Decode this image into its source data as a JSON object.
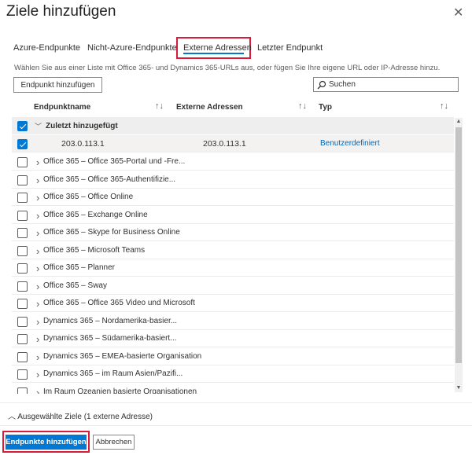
{
  "header": {
    "title": "Ziele hinzufügen",
    "close_glyph": "✕"
  },
  "tabs": [
    {
      "label": "Azure-Endpunkte"
    },
    {
      "label": "Nicht-Azure-Endpunkte"
    },
    {
      "label": "Externe Adressen",
      "active": true
    },
    {
      "label": "Letzter Endpunkt"
    }
  ],
  "description": "Wählen Sie aus einer Liste mit Office 365- und Dynamics 365-URLs aus, oder fügen Sie Ihre eigene URL oder IP-Adresse hinzu.",
  "toolbar": {
    "add_endpoint_label": "Endpunkt hinzufügen"
  },
  "search": {
    "placeholder": "Suchen",
    "icon": "search-icon"
  },
  "table": {
    "columns": [
      {
        "label": "Endpunktname"
      },
      {
        "label": "Externe Adressen"
      },
      {
        "label": "Typ"
      }
    ],
    "sort_glyph": "↑↓",
    "group_header": {
      "label": "Zuletzt hinzugefügt",
      "checked": true,
      "expanded": true
    },
    "selected_row": {
      "name": "203.0.113.1",
      "address": "203.0.113.1",
      "type": "Benutzerdefiniert",
      "checked": true
    },
    "rows": [
      {
        "label": "Office 365 – Office 365-Portal und -Fre..."
      },
      {
        "label": "Office 365 – Office 365-Authentifizie..."
      },
      {
        "label": "Office 365 – Office Online"
      },
      {
        "label": "Office 365 – Exchange Online"
      },
      {
        "label": "Office 365 – Skype for Business Online"
      },
      {
        "label": "Office 365 – Microsoft Teams"
      },
      {
        "label": "Office 365 – Planner"
      },
      {
        "label": "Office 365 – Sway"
      },
      {
        "label": "Office 365 – Office 365 Video und Microsoft"
      },
      {
        "label": "Dynamics 365 – Nordamerika-basier..."
      },
      {
        "label": "Dynamics 365 – Südamerika-basiert..."
      },
      {
        "label": "Dynamics 365 – EMEA-basierte Organisation"
      },
      {
        "label": "Dynamics 365 – im Raum Asien/Pazifi..."
      },
      {
        "label": "Im Raum Ozeanien basierte Organisationen"
      }
    ]
  },
  "selection_summary": "Ausgewählte Ziele (1 externe Adresse)",
  "footer": {
    "primary_label": "Endpunkte hinzufügen",
    "cancel_label": "Abbrechen"
  },
  "colors": {
    "accent": "#0078d4",
    "highlight_frame": "#d71d3c",
    "link": "#0067b8"
  }
}
